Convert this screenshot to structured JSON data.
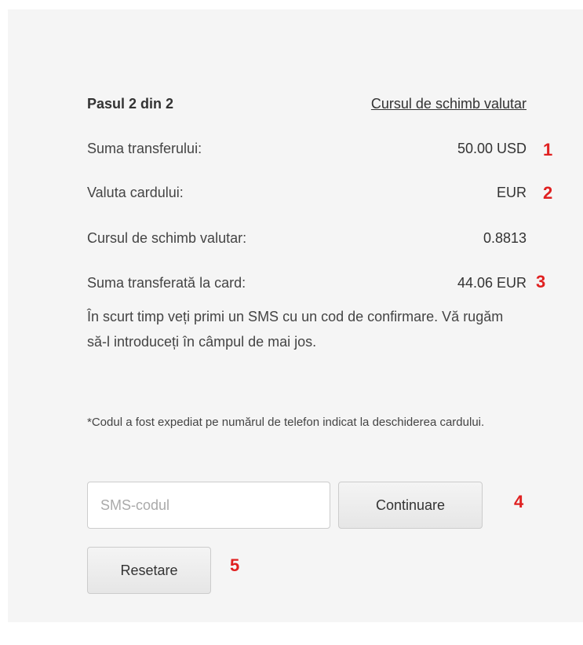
{
  "step": {
    "title": "Pasul 2 din 2",
    "exchange_rate_link": "Cursul de schimb valutar"
  },
  "details": [
    {
      "label": "Suma transferului:",
      "value": "50.00 USD",
      "marker": "1"
    },
    {
      "label": "Valuta cardului:",
      "value": "EUR",
      "marker": "2"
    },
    {
      "label": "Cursul de schimb valutar:",
      "value": "0.8813",
      "marker": ""
    },
    {
      "label": "Suma transferată la card:",
      "value": "44.06 EUR",
      "marker": "3"
    }
  ],
  "info_text": "În scurt timp veți primi un SMS cu un cod de confirmare. Vă rugăm să-l introduceți în câmpul de mai jos.",
  "note_text": "*Codul a fost expediat pe numărul de telefon indicat la deschiderea cardului.",
  "sms_input": {
    "placeholder": "SMS-codul",
    "value": ""
  },
  "continue_button": {
    "label": "Continuare",
    "marker": "4"
  },
  "reset_button": {
    "label": "Resetare",
    "marker": "5"
  },
  "colors": {
    "link": "#2b7bc8",
    "marker": "#e02020",
    "panel": "#f5f5f5"
  }
}
